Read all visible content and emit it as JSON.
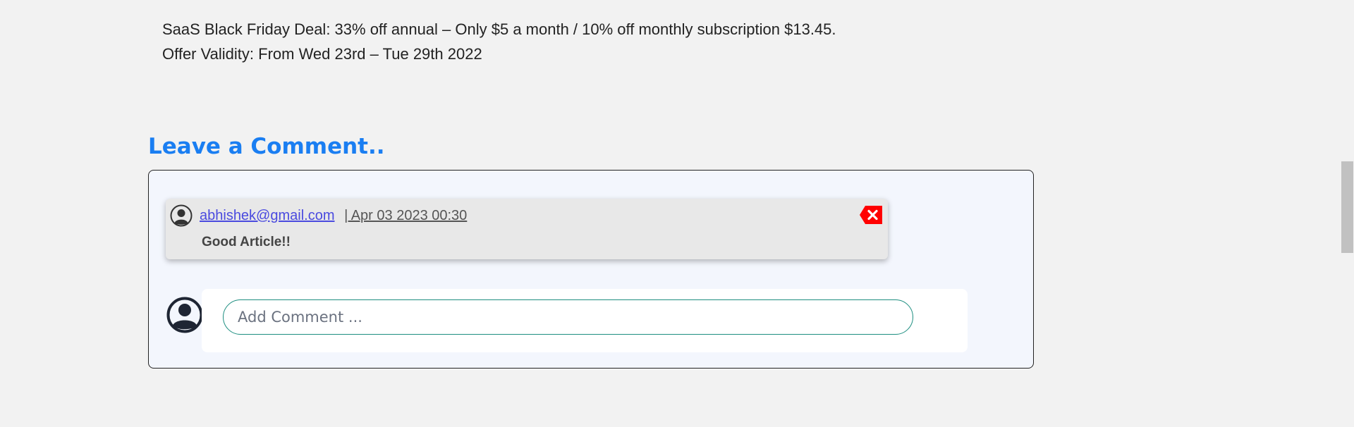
{
  "deal": {
    "line1": "SaaS Black Friday Deal: 33% off annual – Only $5 a month / 10% off monthly subscription $13.45.",
    "line2": "Offer Validity: From Wed 23rd – Tue 29th 2022"
  },
  "comments_section": {
    "title": "Leave a Comment..",
    "comments": [
      {
        "email": "abhishek@gmail.com",
        "date": "| Apr 03 2023 00:30",
        "text": "Good Article!!"
      }
    ],
    "input": {
      "placeholder": "Add Comment ...",
      "value": ""
    }
  },
  "icons": {
    "avatar": "user-avatar-icon",
    "delete": "delete-icon"
  },
  "colors": {
    "title": "#1a7ef2",
    "link": "#4a4adf",
    "delete": "#ff0000",
    "input_border": "#1d8e80",
    "box_background": "#f3f6fd"
  }
}
